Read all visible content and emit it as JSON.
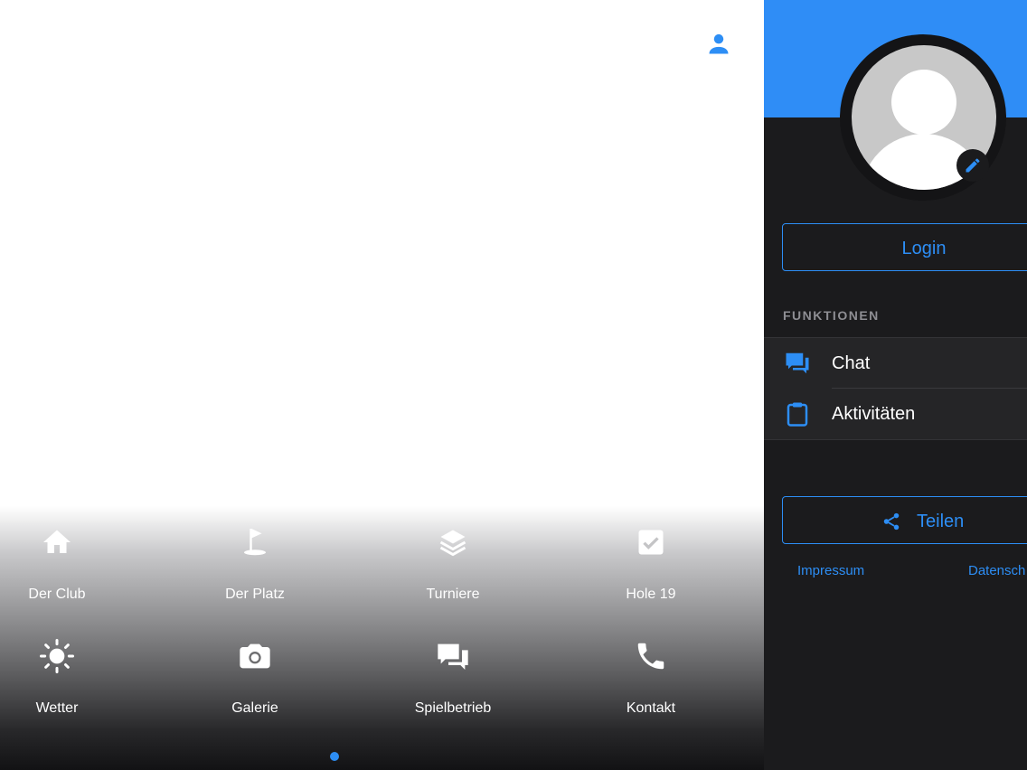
{
  "main": {
    "tiles": [
      {
        "label": "Der Club",
        "icon": "home-icon"
      },
      {
        "label": "Der Platz",
        "icon": "golf-flag-icon"
      },
      {
        "label": "Turniere",
        "icon": "layers-icon"
      },
      {
        "label": "Hole 19",
        "icon": "checkbox-icon"
      },
      {
        "label": "Wetter",
        "icon": "sun-icon"
      },
      {
        "label": "Galerie",
        "icon": "camera-icon"
      },
      {
        "label": "Spielbetrieb",
        "icon": "chat-bubbles-icon"
      },
      {
        "label": "Kontakt",
        "icon": "phone-icon"
      }
    ],
    "user_icon": "person-icon",
    "page_indicator": {
      "current": 1,
      "total": 1
    }
  },
  "sidebar": {
    "login_label": "Login",
    "section_title": "FUNKTIONEN",
    "functions": [
      {
        "label": "Chat",
        "icon": "chat-icon"
      },
      {
        "label": "Aktivitäten",
        "icon": "clipboard-icon"
      }
    ],
    "share_label": "Teilen",
    "share_icon": "share-icon",
    "footer": {
      "impressum": "Impressum",
      "datenschutz": "Datensch"
    }
  },
  "colors": {
    "accent": "#2d8ef5",
    "sidebar_bg": "#1b1b1d",
    "list_bg": "#252527",
    "header_blue": "#2f8df6"
  }
}
